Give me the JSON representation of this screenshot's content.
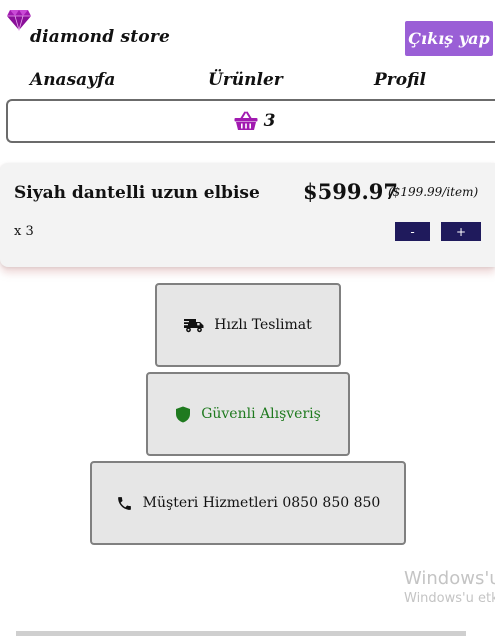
{
  "brand": {
    "name": "diamond store",
    "logo_icon": "diamond-icon",
    "logo_color": "#a11ab0"
  },
  "header": {
    "logout_label": "Çıkış yap",
    "logout_color": "#9a5fd6"
  },
  "nav": {
    "items": [
      {
        "label": "Anasayfa"
      },
      {
        "label": "Ürünler"
      },
      {
        "label": "Profil"
      }
    ]
  },
  "cart": {
    "icon": "basket-icon",
    "icon_color": "#a11ab0",
    "count": "3"
  },
  "cart_item": {
    "name": "Siyah dantelli uzun elbise",
    "total_price": "$599.97",
    "unit_price": "($199.99/item)",
    "quantity": "x 3",
    "minus_label": "-",
    "plus_label": "+",
    "button_color": "#1f1a5c"
  },
  "features": [
    {
      "icon": "truck-icon",
      "label": "Hızlı Teslimat"
    },
    {
      "icon": "shield-icon",
      "label": "Güvenli Alışveriş",
      "color": "#1f7a1f"
    },
    {
      "icon": "phone-icon",
      "label": "Müşteri Hizmetleri 0850 850 850"
    }
  ],
  "watermark": {
    "line1": "Windows'u",
    "line2": "Windows'u etk"
  }
}
